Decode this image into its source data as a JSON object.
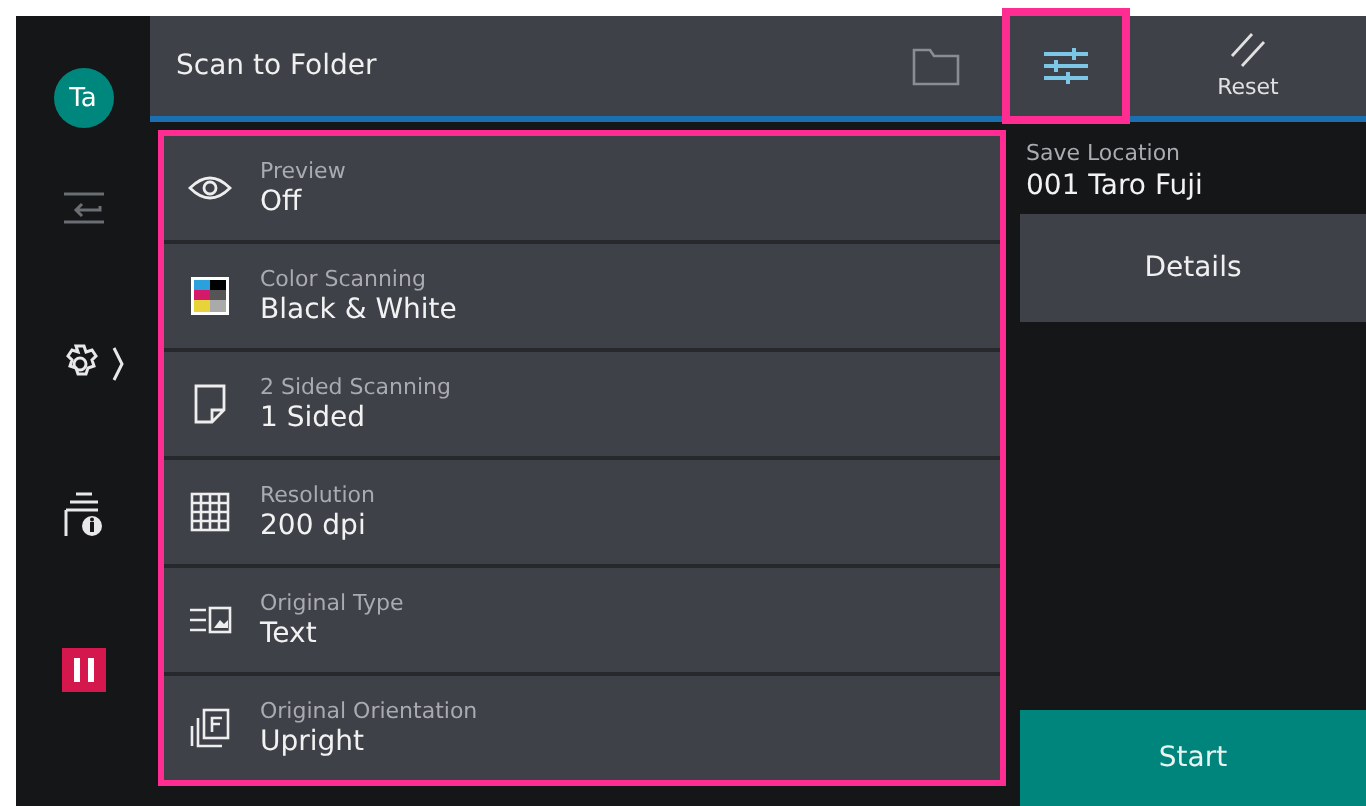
{
  "sidebar": {
    "avatar": "Ta"
  },
  "header": {
    "title": "Scan to Folder",
    "tabs": [
      {
        "kind": "folder",
        "selected": false,
        "highlighted": false
      },
      {
        "kind": "settings",
        "selected": true,
        "highlighted": true
      },
      {
        "kind": "reset",
        "label": "Reset",
        "selected": false,
        "highlighted": false
      }
    ]
  },
  "settings": {
    "highlighted": true,
    "items": [
      {
        "kind": "eye",
        "label": "Preview",
        "value": "Off"
      },
      {
        "kind": "color",
        "label": "Color Scanning",
        "value": "Black & White"
      },
      {
        "kind": "page",
        "label": "2 Sided Scanning",
        "value": "1 Sided"
      },
      {
        "kind": "grid",
        "label": "Resolution",
        "value": "200 dpi"
      },
      {
        "kind": "type",
        "label": "Original Type",
        "value": "Text"
      },
      {
        "kind": "orient",
        "label": "Original Orientation",
        "value": "Upright"
      }
    ]
  },
  "save_location": {
    "label": "Save Location",
    "value": "001 Taro Fuji"
  },
  "buttons": {
    "details": "Details",
    "start": "Start"
  }
}
